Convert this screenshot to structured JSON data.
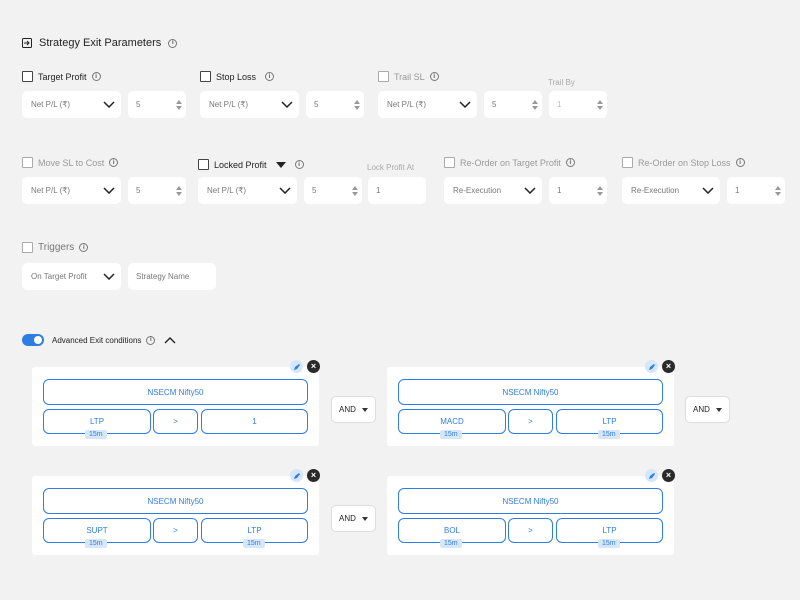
{
  "header": {
    "title": "Strategy Exit Parameters"
  },
  "row1": {
    "target_profit": {
      "label": "Target Profit",
      "select": "Net P/L (₹)",
      "value": "5"
    },
    "stop_loss": {
      "label": "Stop Loss",
      "select": "Net P/L (₹)",
      "value": "5"
    },
    "trail_sl": {
      "label": "Trail SL",
      "select": "Net P/L (₹)",
      "value": "5",
      "trail_by_label": "Trail By",
      "trail_by_value": "1"
    }
  },
  "row2": {
    "move_sl": {
      "label": "Move SL to Cost",
      "select": "Net P/L (₹)",
      "value": "5"
    },
    "locked_profit": {
      "label": "Locked Profit",
      "select": "Net P/L (₹)",
      "value": "5",
      "lock_at_label": "Lock Profit At",
      "lock_at_value": "1"
    },
    "reorder_tp": {
      "label": "Re-Order on Target Profit",
      "select": "Re-Execution",
      "value": "1"
    },
    "reorder_sl": {
      "label": "Re-Order on Stop Loss",
      "select": "Re-Execution",
      "value": "1"
    }
  },
  "triggers": {
    "label": "Triggers",
    "select": "On Target Profit",
    "placeholder": "Strategy Name"
  },
  "advanced": {
    "label": "Advanced Exit conditions",
    "enabled": true
  },
  "conditions": [
    {
      "instrument": "NSECM Nifty50",
      "left": "LTP",
      "left_tf": "15m",
      "op": ">",
      "right": "1",
      "right_tf": ""
    },
    {
      "instrument": "NSECM Nifty50",
      "left": "MACD",
      "left_tf": "15m",
      "op": ">",
      "right": "LTP",
      "right_tf": "15m"
    },
    {
      "instrument": "NSECM Nifty50",
      "left": "SUPT",
      "left_tf": "15m",
      "op": ">",
      "right": "LTP",
      "right_tf": "15m"
    },
    {
      "instrument": "NSECM Nifty50",
      "left": "BOL",
      "left_tf": "15m",
      "op": ">",
      "right": "LTP",
      "right_tf": "15m"
    }
  ],
  "joins": [
    "AND",
    "AND",
    "AND"
  ],
  "colors": {
    "accent": "#2f7de1",
    "pill_bg": "#d6e6fb",
    "page_bg": "#f2f2f3"
  }
}
